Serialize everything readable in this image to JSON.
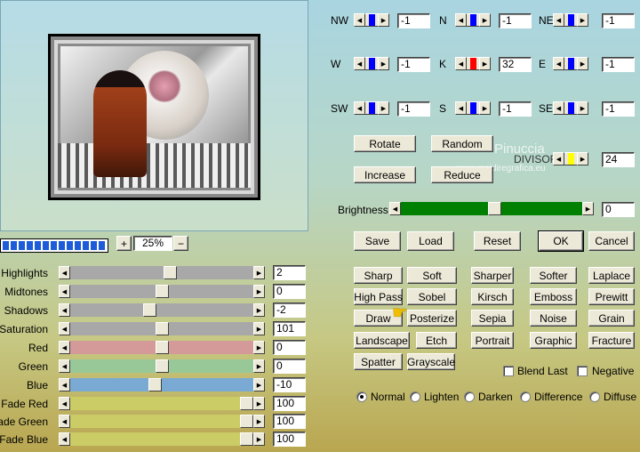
{
  "preview": {
    "zoom_value": "25%",
    "zoom_in": "+",
    "zoom_out": "−",
    "progress_segments": 13
  },
  "directions": [
    {
      "label": "NW",
      "value": "-1",
      "color": "#0000ff"
    },
    {
      "label": "N",
      "value": "-1",
      "color": "#0000ff"
    },
    {
      "label": "NE",
      "value": "-1",
      "color": "#0000ff"
    },
    {
      "label": "W",
      "value": "-1",
      "color": "#0000ff"
    },
    {
      "label": "K",
      "value": "32",
      "color": "#ff0000"
    },
    {
      "label": "E",
      "value": "-1",
      "color": "#0000ff"
    },
    {
      "label": "SW",
      "value": "-1",
      "color": "#0000ff"
    },
    {
      "label": "S",
      "value": "-1",
      "color": "#0000ff"
    },
    {
      "label": "SE",
      "value": "-1",
      "color": "#0000ff"
    }
  ],
  "divisor": {
    "label": "DIVISOR",
    "value": "24",
    "color": "#ffff00"
  },
  "buttons": {
    "rotate": "Rotate",
    "random": "Random",
    "increase": "Increase",
    "reduce": "Reduce",
    "save": "Save",
    "load": "Load",
    "reset": "Reset",
    "ok": "OK",
    "cancel": "Cancel"
  },
  "watermark": {
    "line1": "Pinuccia",
    "line2": "www.maidiregrafica.eu"
  },
  "brightness": {
    "label": "Brightness",
    "value": "0",
    "level": 0.52,
    "color": "#008000"
  },
  "filters": [
    [
      "Sharp",
      "Soft",
      "Sharper",
      "Softer",
      "Laplace"
    ],
    [
      "High Pass",
      "Sobel",
      "Kirsch",
      "Emboss",
      "Prewitt"
    ],
    [
      "Draw",
      "Posterize",
      "Sepia",
      "Noise",
      "Grain"
    ],
    [
      "Landscape",
      "Etch",
      "Portrait",
      "Graphic",
      "Fracture"
    ],
    [
      "Spatter",
      "Grayscale"
    ]
  ],
  "checks": {
    "blend_last": "Blend Last",
    "negative": "Negative"
  },
  "modes": [
    {
      "label": "Normal",
      "selected": true
    },
    {
      "label": "Lighten",
      "selected": false
    },
    {
      "label": "Darken",
      "selected": false
    },
    {
      "label": "Difference",
      "selected": false
    },
    {
      "label": "Diffuse",
      "selected": false
    }
  ],
  "sliders": [
    {
      "label": "Highlights",
      "value": "2",
      "level": 0.55,
      "color": "#a8a8a8"
    },
    {
      "label": "Midtones",
      "value": "0",
      "level": 0.5,
      "color": "#a8a8a8"
    },
    {
      "label": "Shadows",
      "value": "-2",
      "level": 0.43,
      "color": "#a8a8a8"
    },
    {
      "label": "Saturation",
      "value": "101",
      "level": 0.5,
      "color": "#a8a8a8"
    },
    {
      "label": "Red",
      "value": "0",
      "level": 0.5,
      "color": "#d49a9a"
    },
    {
      "label": "Green",
      "value": "0",
      "level": 0.5,
      "color": "#98c898"
    },
    {
      "label": "Blue",
      "value": "-10",
      "level": 0.46,
      "color": "#7aaad4"
    },
    {
      "label": "Fade Red",
      "value": "100",
      "level": 1,
      "color": "#cccc66"
    },
    {
      "label": "Fade Green",
      "value": "100",
      "level": 1,
      "color": "#cccc66"
    },
    {
      "label": "Fade Blue",
      "value": "100",
      "level": 1,
      "color": "#cccc66"
    }
  ]
}
